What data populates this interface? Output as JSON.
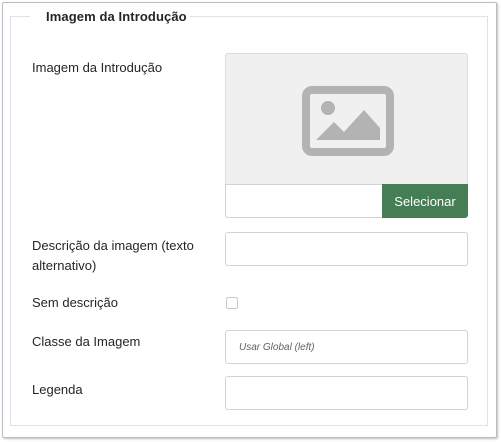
{
  "fieldset": {
    "legend": "Imagem da Introdução"
  },
  "fields": {
    "image": {
      "label": "Imagem da Introdução",
      "path_value": "",
      "select_label": "Selecionar",
      "icon": "image-icon"
    },
    "alt_text": {
      "label_line1": "Descrição da imagem (texto",
      "label_line2": "alternativo)",
      "value": ""
    },
    "no_description": {
      "label": "Sem descrição",
      "checked": false
    },
    "image_class": {
      "label": "Classe da Imagem",
      "placeholder": "Usar Global (left)",
      "value": ""
    },
    "caption": {
      "label": "Legenda",
      "value": ""
    }
  },
  "colors": {
    "select_button": "#457d54",
    "preview_bg": "#f0f0f0",
    "icon": "#b3b3b3"
  }
}
